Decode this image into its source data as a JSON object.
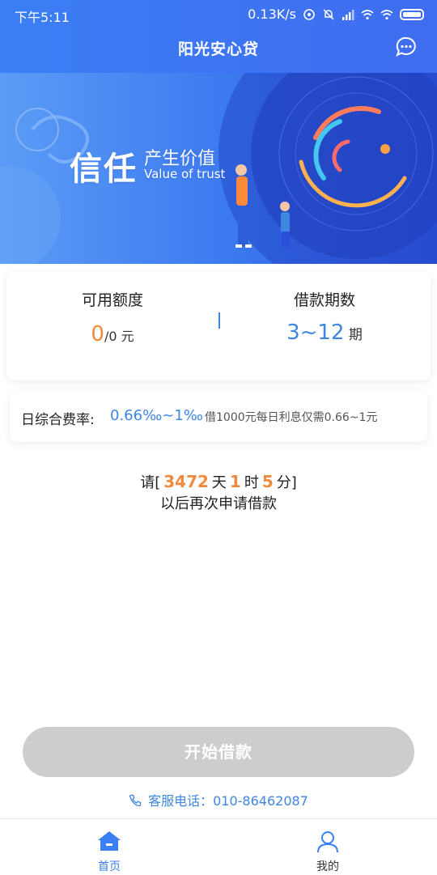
{
  "status_bar": {
    "time": "下午5:11",
    "speed": "0.13K/s"
  },
  "header": {
    "title": "阳光安心贷"
  },
  "banner": {
    "title": "信任",
    "subtitle_cn": "产生价值",
    "subtitle_en": "Value of trust"
  },
  "quota": {
    "available_label": "可用额度",
    "available_value": "0",
    "available_total": "/0 元",
    "period_label": "借款期数",
    "period_value": "3~12",
    "period_unit": "期"
  },
  "rate": {
    "title": "日综合费率:",
    "value": "0.66‰~1‰",
    "note": "借1000元每日利息仅需0.66~1元"
  },
  "countdown": {
    "prefix": "请[",
    "days": "3472",
    "days_unit": "天",
    "hours": "1",
    "hours_unit": "时",
    "minutes": "5",
    "minutes_unit": "分]",
    "line2": "以后再次申请借款"
  },
  "start_button": {
    "label": "开始借款"
  },
  "service": {
    "text": "客服电话：010-86462087"
  },
  "nav": {
    "items": [
      {
        "label": "首页",
        "icon": "home-icon",
        "active": true
      },
      {
        "label": "我的",
        "icon": "user-icon",
        "active": false
      }
    ]
  },
  "colors": {
    "primary": "#3b7ff4",
    "accent_orange": "#f08a3c",
    "accent_blue": "#3e86e0",
    "disabled_button": "#cdcdcd"
  }
}
